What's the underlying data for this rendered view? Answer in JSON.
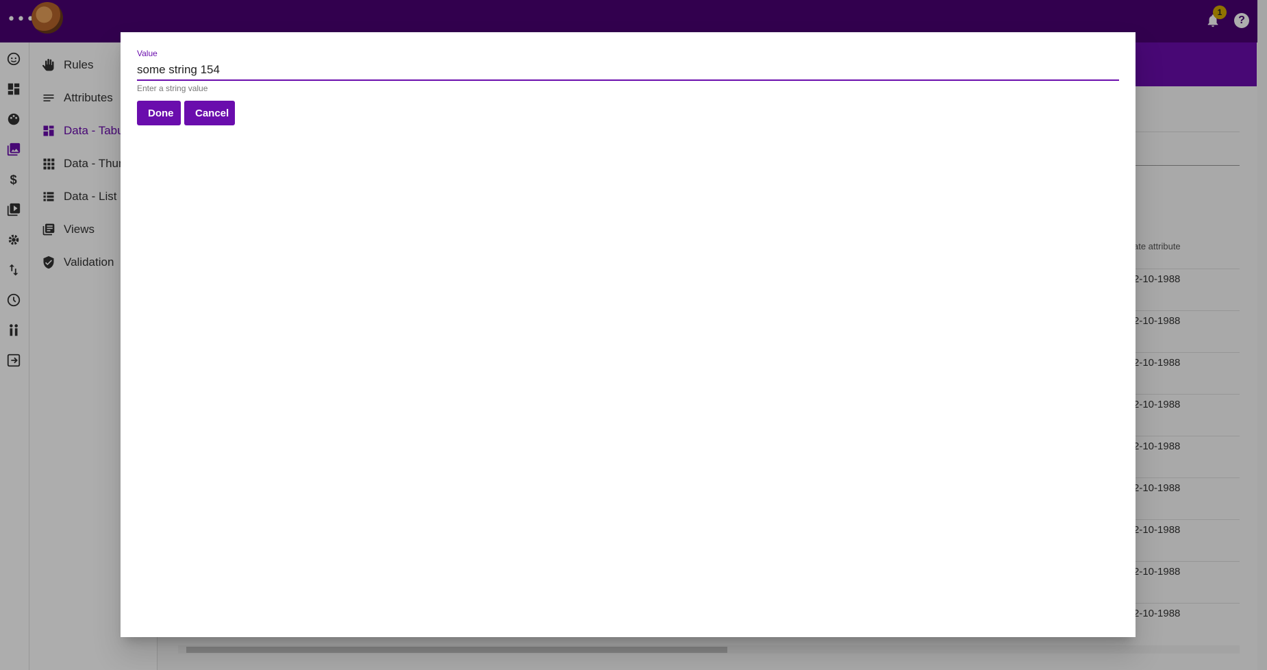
{
  "topbar": {
    "menu_glyph": "•••",
    "notification_count": "1",
    "help_glyph": "?"
  },
  "rail": {
    "icons": [
      "face-icon",
      "dashboard-icon",
      "palette-icon",
      "photo-library-icon",
      "dollar-icon",
      "video-library-icon",
      "gear-icon",
      "swap-vert-icon",
      "clock-icon",
      "people-icon",
      "exit-icon"
    ]
  },
  "sidebar": {
    "items": [
      {
        "label": "Rules",
        "icon": "hand-icon"
      },
      {
        "label": "Attributes",
        "icon": "list-lines-icon"
      },
      {
        "label": "Data - Tabul",
        "icon": "table-icon",
        "active": true
      },
      {
        "label": "Data - Thum",
        "icon": "grid-icon"
      },
      {
        "label": "Data - List",
        "icon": "list-icon"
      },
      {
        "label": "Views",
        "icon": "views-icon"
      },
      {
        "label": "Validation",
        "icon": "shield-check-icon"
      }
    ]
  },
  "table": {
    "column_header": "ate attribute",
    "cells": [
      "2-10-1988",
      "2-10-1988",
      "2-10-1988",
      "2-10-1988",
      "2-10-1988",
      "2-10-1988",
      "2-10-1988",
      "2-10-1988",
      "2-10-1988"
    ]
  },
  "dialog": {
    "field_label": "Value",
    "field_value": "some string 154",
    "field_hint": "Enter a string value",
    "done_label": "Done",
    "cancel_label": "Cancel"
  },
  "colors": {
    "primary": "#6a0dad",
    "topbar": "#4a0073",
    "badge": "#d4a800"
  }
}
